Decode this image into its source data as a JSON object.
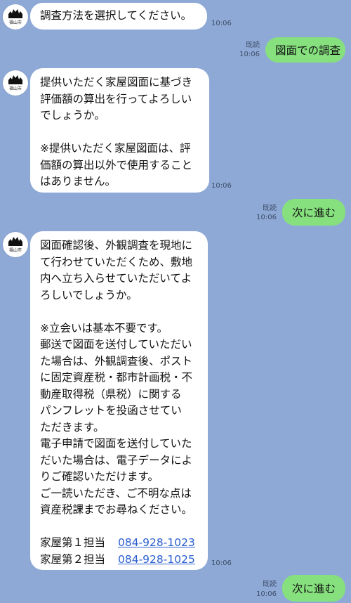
{
  "bot": {
    "avatar_caption": "福山市"
  },
  "messages": [
    {
      "id": "m1",
      "side": "in",
      "text": "調査方法を選択してください。",
      "time": "10:06"
    },
    {
      "id": "m2",
      "side": "out",
      "text": "図面での調査",
      "read": "既読",
      "time": "10:06"
    },
    {
      "id": "m3",
      "side": "in",
      "lines_a": [
        "提供いただく家屋図面に基づき",
        "評価額の算出を行ってよろしい",
        "でしょうか。"
      ],
      "lines_b": [
        "※提供いただく家屋図面は、評",
        "価額の算出以外で使用すること",
        "はありません。"
      ],
      "time": "10:06"
    },
    {
      "id": "m4",
      "side": "out",
      "text": "次に進む",
      "read": "既読",
      "time": "10:06"
    },
    {
      "id": "m5",
      "side": "in",
      "lines_a": [
        "図面確認後、外観調査を現地に",
        "て行わせていただくため、敷地",
        "内へ立ち入らせていただいてよ",
        "ろしいでしょうか。"
      ],
      "lines_b": [
        "※立会いは基本不要です。",
        "郵送で図面を送付していただい",
        "た場合は、外観調査後、ポスト",
        "に固定資産税・都市計画税・不",
        "動産取得税（県税）に関する",
        "パンフレットを投函させてい",
        "ただきます。",
        "電子申請で図面を送付していた",
        "だいた場合は、電子データによ",
        "りご確認いただけます。",
        "ご一読いただき、ご不明な点は",
        "資産税課までお尋ねください。"
      ],
      "contacts": [
        {
          "label": "家屋第１担当",
          "phone": "084-928-1023"
        },
        {
          "label": "家屋第２担当",
          "phone": "084-928-1025"
        }
      ],
      "time": "10:06"
    },
    {
      "id": "m6",
      "side": "out",
      "text": "次に進む",
      "read": "既読",
      "time": "10:06"
    }
  ]
}
